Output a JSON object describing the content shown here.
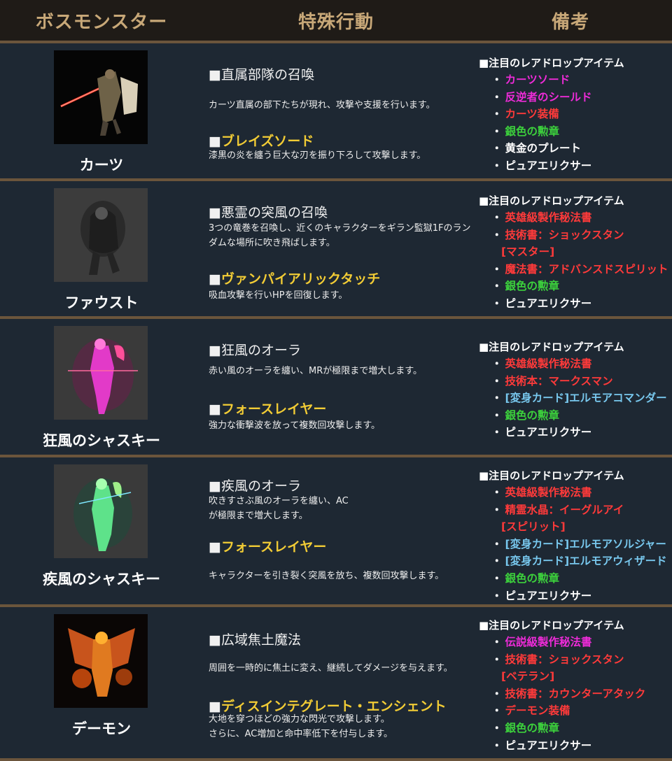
{
  "header": {
    "boss": "ボスモンスター",
    "action": "特殊行動",
    "notes": "備考"
  },
  "drop_heading": "■注目のレアドロップアイテム",
  "square": "■",
  "bullet": "・",
  "colors": {
    "magenta": "#ee2bd8",
    "red": "#ff3a3a",
    "green": "#3cd13c",
    "white": "#ffffff",
    "blue": "#78c8ee",
    "gold": "#f2cc35"
  },
  "bosses": [
    {
      "name": "カーツ",
      "portrait_icon": "kurtz-knight-portrait-icon",
      "action1": {
        "title": "直属部隊の召喚",
        "desc": "カーツ直属の部下たちが現れ、攻撃や支援を行います。"
      },
      "action2": {
        "title": "ブレイズソード",
        "desc": "漆黒の炎を纏う巨大な刃を振り下ろして攻撃します。"
      },
      "drops": [
        {
          "text": "カーツソード",
          "color": "magenta"
        },
        {
          "text": "反逆者のシールド",
          "color": "magenta"
        },
        {
          "text": "カーツ装備",
          "color": "red"
        },
        {
          "text": "銀色の勲章",
          "color": "green"
        },
        {
          "text": "黄金のプレート",
          "color": "white"
        },
        {
          "text": "ピュアエリクサー",
          "color": "white"
        }
      ]
    },
    {
      "name": "ファウスト",
      "portrait_icon": "faust-ghost-portrait-icon",
      "action1": {
        "title": "悪霊の突風の召喚",
        "desc": "3つの竜巻を召喚し、近くのキャラクターをギラン監獄1Fのランダムな場所に吹き飛ばします。"
      },
      "action2": {
        "title": "ヴァンパイアリックタッチ",
        "desc": "吸血攻撃を行いHPを回復します。"
      },
      "drops": [
        {
          "text": "英雄級製作秘法書",
          "color": "red"
        },
        {
          "text": "技術書：ショックスタン",
          "color": "red"
        },
        {
          "text": "[マスター]",
          "color": "red",
          "cont": true
        },
        {
          "text": "魔法書：アドバンスドスピリット",
          "color": "red"
        },
        {
          "text": "銀色の勲章",
          "color": "green"
        },
        {
          "text": "ピュアエリクサー",
          "color": "white"
        }
      ]
    },
    {
      "name": "狂風のシャスキー",
      "portrait_icon": "shasky-red-portrait-icon",
      "action1": {
        "title": "狂風のオーラ",
        "desc": "赤い風のオーラを纏い、MRが極限まで増大します。"
      },
      "action2": {
        "title": "フォースレイヤー",
        "desc": "強力な衝撃波を放って複数回攻撃します。"
      },
      "drops": [
        {
          "text": "英雄級製作秘法書",
          "color": "red"
        },
        {
          "text": "技術本：マークスマン",
          "color": "red"
        },
        {
          "text": "[変身カード]エルモアコマンダー",
          "color": "blue"
        },
        {
          "text": "銀色の勲章",
          "color": "green"
        },
        {
          "text": "ピュアエリクサー",
          "color": "white"
        }
      ]
    },
    {
      "name": "疾風のシャスキー",
      "portrait_icon": "shasky-green-portrait-icon",
      "action1": {
        "title": "疾風のオーラ",
        "desc": "吹きすさぶ風のオーラを纏い、AC\nが極限まで増大します。"
      },
      "action2": {
        "title": "フォースレイヤー",
        "desc": "キャラクターを引き裂く突風を放ち、複数回攻撃します。"
      },
      "drops": [
        {
          "text": "英雄級製作秘法書",
          "color": "red"
        },
        {
          "text": "精霊水晶：イーグルアイ",
          "color": "red"
        },
        {
          "text": "[スピリット]",
          "color": "red",
          "cont": true
        },
        {
          "text": "[変身カード]エルモアソルジャー",
          "color": "blue"
        },
        {
          "text": "[変身カード]エルモアウィザード",
          "color": "blue"
        },
        {
          "text": "銀色の勲章",
          "color": "green"
        },
        {
          "text": "ピュアエリクサー",
          "color": "white"
        }
      ]
    },
    {
      "name": "デーモン",
      "portrait_icon": "demon-winged-portrait-icon",
      "action1": {
        "title": "広域焦土魔法",
        "desc": "周囲を一時的に焦土に変え、継続してダメージを与えます。"
      },
      "action2": {
        "title": "ディスインテグレート・エンシェント",
        "desc": "大地を穿つほどの強力な閃光で攻撃します。\nさらに、AC増加と命中率低下を付与します。"
      },
      "drops": [
        {
          "text": "伝説級製作秘法書",
          "color": "magenta"
        },
        {
          "text": "技術書：ショックスタン",
          "color": "red"
        },
        {
          "text": "[ベテラン]",
          "color": "red",
          "cont": true
        },
        {
          "text": "技術書：カウンターアタック",
          "color": "red"
        },
        {
          "text": "デーモン装備",
          "color": "red"
        },
        {
          "text": "銀色の勲章",
          "color": "green"
        },
        {
          "text": "ピュアエリクサー",
          "color": "white"
        }
      ]
    }
  ]
}
